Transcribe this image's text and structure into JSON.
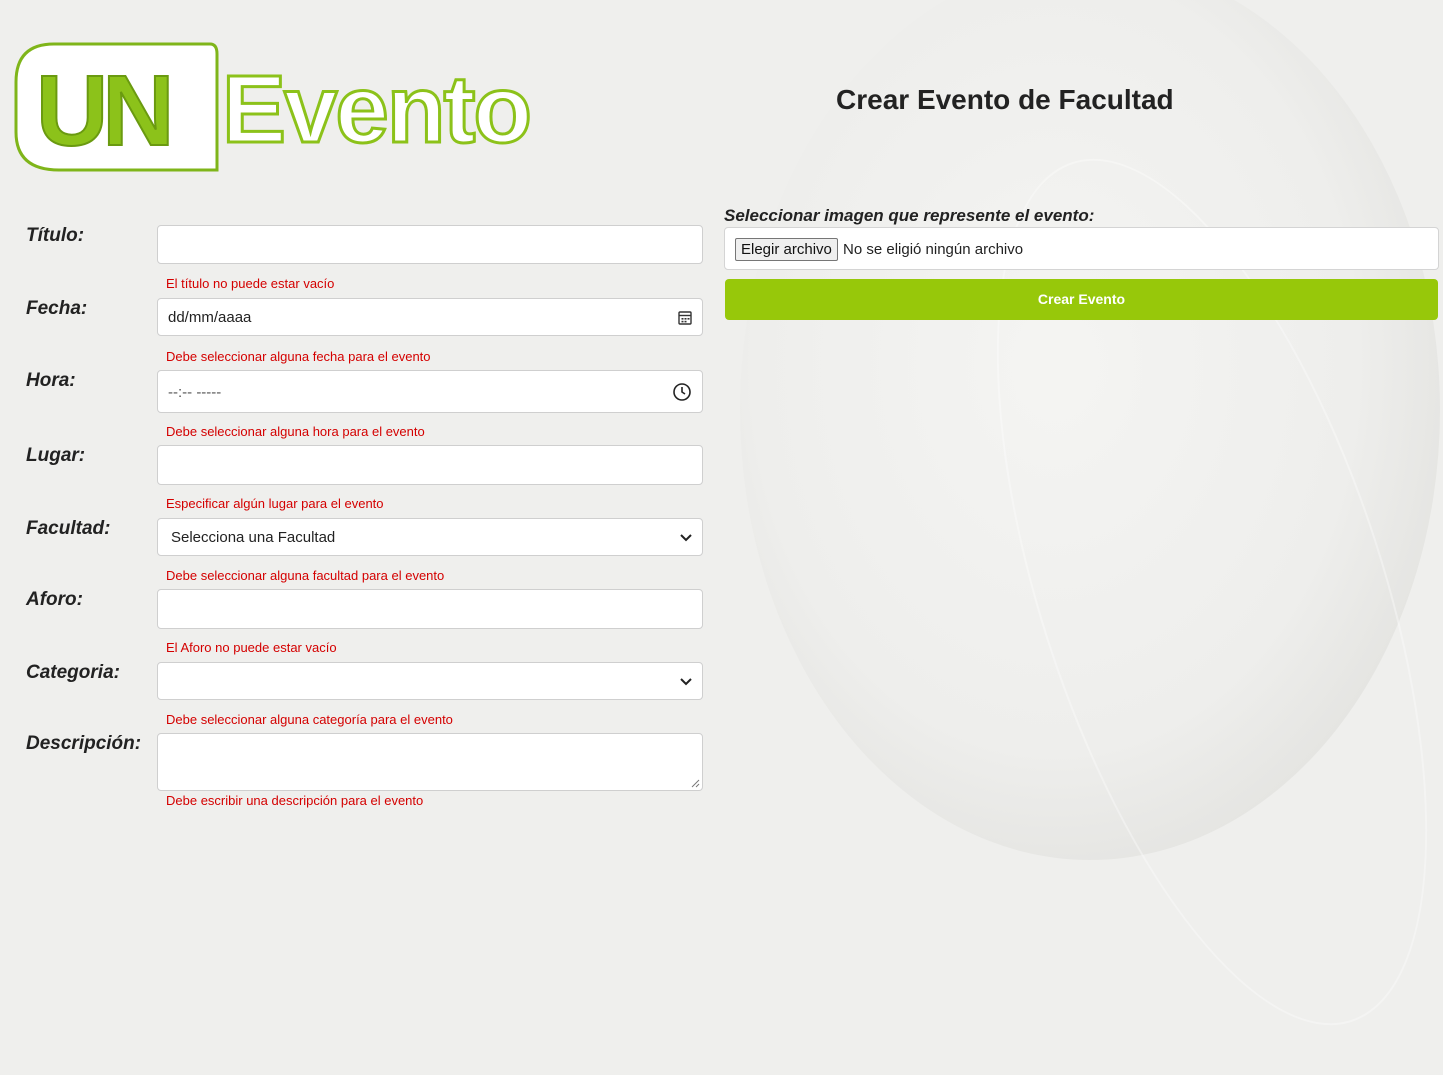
{
  "brand": {
    "part1": "UN",
    "part2": "Evento",
    "accent": "#8cc21a"
  },
  "page": {
    "title": "Crear Evento de Facultad"
  },
  "form": {
    "fields": [
      {
        "label": "Título:",
        "value": "",
        "error": "El título no puede estar vacío"
      },
      {
        "label": "Fecha:",
        "value": "dd/mm/aaaa",
        "error": "Debe seleccionar alguna fecha para el evento"
      },
      {
        "label": "Hora:",
        "value": "--:-- -----",
        "error": "Debe seleccionar alguna hora para el evento"
      },
      {
        "label": "Lugar:",
        "value": "",
        "error": "Especificar algún lugar para el evento"
      },
      {
        "label": "Facultad:",
        "value": "Selecciona una Facultad",
        "error": "Debe seleccionar alguna facultad para el evento"
      },
      {
        "label": "Aforo:",
        "value": "",
        "error": "El Aforo no puede estar vacío"
      },
      {
        "label": "Categoria:",
        "value": "",
        "error": "Debe seleccionar alguna categoría para el evento"
      },
      {
        "label": "Descripción:",
        "value": "",
        "error": "Debe escribir una descripción para el evento"
      }
    ],
    "image": {
      "label": "Seleccionar imagen que represente el evento:",
      "button": "Elegir archivo",
      "status": "No se eligió ningún archivo"
    },
    "submit": "Crear Evento",
    "error_color": "#d40000",
    "submit_color": "#97c80a"
  }
}
